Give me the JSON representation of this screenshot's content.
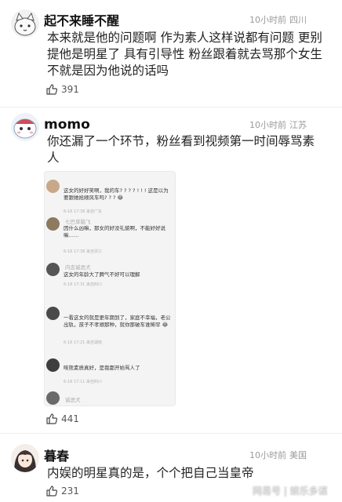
{
  "comments": [
    {
      "username": "起不来睡不醒",
      "time": "10小时前",
      "location": "四川",
      "text": "本来就是他的问题啊 作为素人这样说都有问题 更别提他是明星了 具有引导性 粉丝跟着就去骂那个女生 不就是因为他说的话吗",
      "likes": "391",
      "avatar_icon": "cartoon-cat-avatar-icon"
    },
    {
      "username": "momo",
      "time": "10小时前",
      "location": "江苏",
      "text": "你还漏了一个环节，粉丝看到视频第一时间辱骂素人",
      "likes": "441",
      "avatar_icon": "cartoon-character-avatar-icon"
    },
    {
      "username": "暮春",
      "time": "10小时前",
      "location": "美国",
      "text": "内娱的明星真的是，个个把自己当皇帝",
      "likes": "231",
      "avatar_icon": "anime-girl-avatar-icon"
    }
  ],
  "embedded": {
    "items": [
      {
        "text": "这女的好好笑啊，我的车? ? ? ? ! ! ! 这是以为要跟她抢顺风车吗? ? ? 😂",
        "meta": "6-18 17:38 来自广东"
      },
      {
        "name": "七巴草脑飞",
        "text": "因什么凶嘛，那女的好没礼貌啊，不能好好说嘛……",
        "meta": "6-18 17:38 来自浙江"
      },
      {
        "name": "内忠诚恶犬",
        "text": "这女的年龄大了脾气不好可以理解",
        "meta": "6-18 17:31 来自四川"
      },
      {
        "text": "一看这女的就是更年期到了，家庭不幸福，老公出轨，孩子不孝顺那种，就你那破车谁稀罕 😂",
        "meta": "6-18 17:21 来自湖南"
      },
      {
        "text": "唉熊素质真好，是我都开始骂人了",
        "meta": "6-18 17:11 来自四川"
      },
      {
        "name": "诚恶犬",
        "text": "",
        "meta": ""
      }
    ]
  },
  "watermark": "网易号 | 娱乐多谋"
}
